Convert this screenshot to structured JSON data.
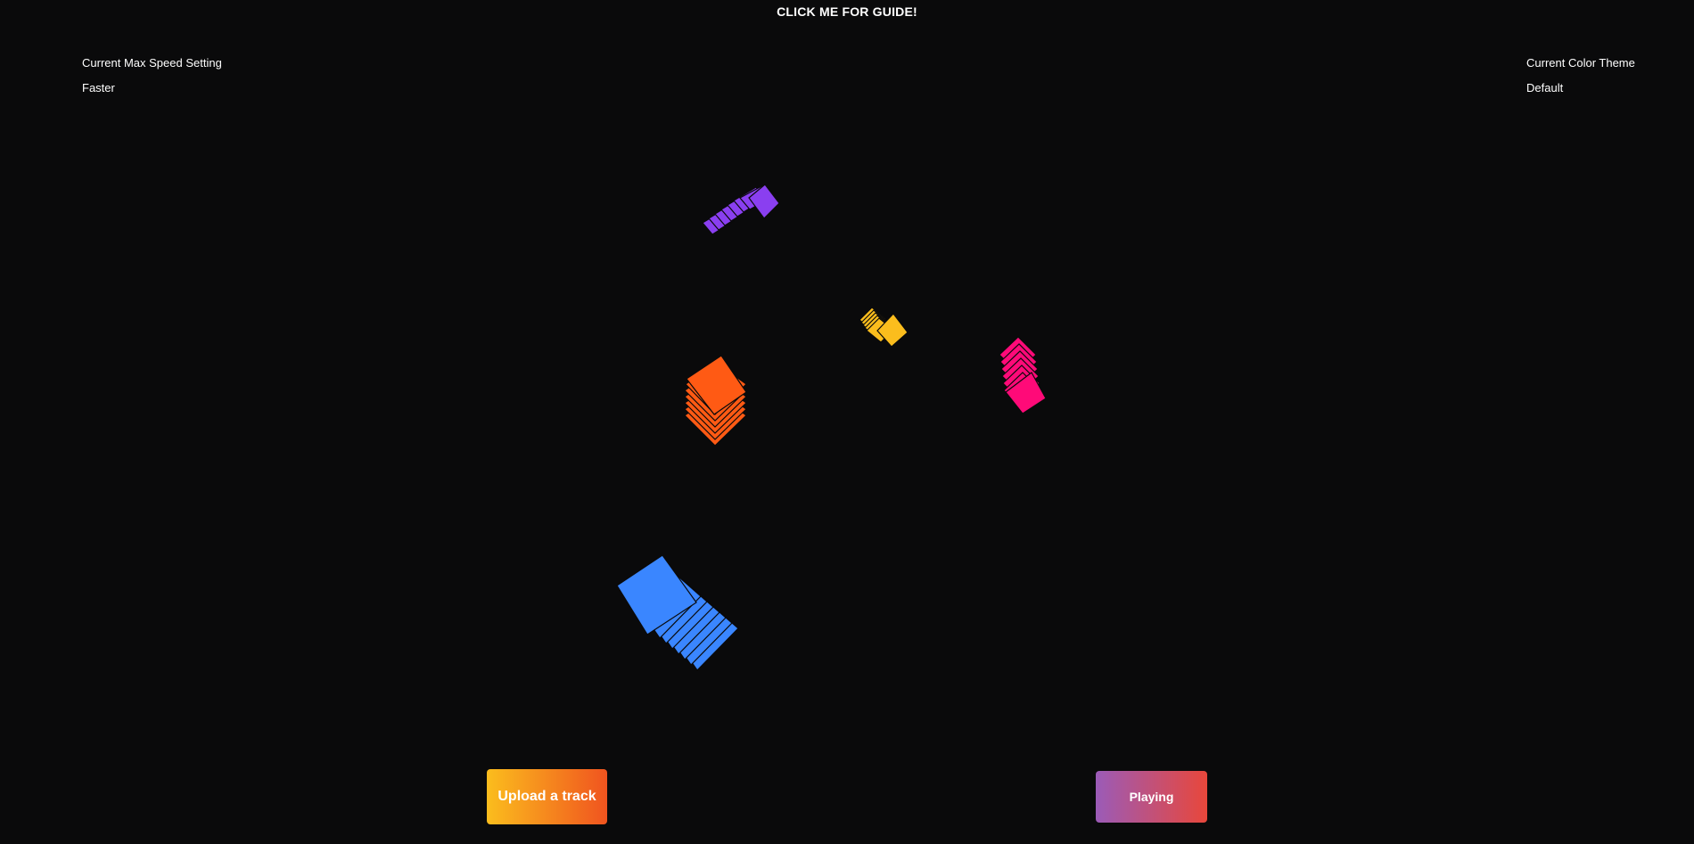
{
  "header": {
    "guide_label": "CLICK ME FOR GUIDE!"
  },
  "speed_panel": {
    "title": "Current Max Speed Setting",
    "value": "Faster"
  },
  "theme_panel": {
    "title": "Current Color Theme",
    "value": "Default"
  },
  "controls": {
    "upload_label": "Upload a track",
    "play_label": "Playing"
  },
  "colors": {
    "background": "#0a0a0b",
    "purple": "#8a3ff0",
    "orange": "#ff5a14",
    "yellow": "#fbbd1d",
    "pink": "#ff0a78",
    "blue": "#3a86ff",
    "upload_gradient": [
      "#fbbd1d",
      "#f0541f"
    ],
    "play_gradient": [
      "#9b5bb8",
      "#e8473b"
    ]
  }
}
